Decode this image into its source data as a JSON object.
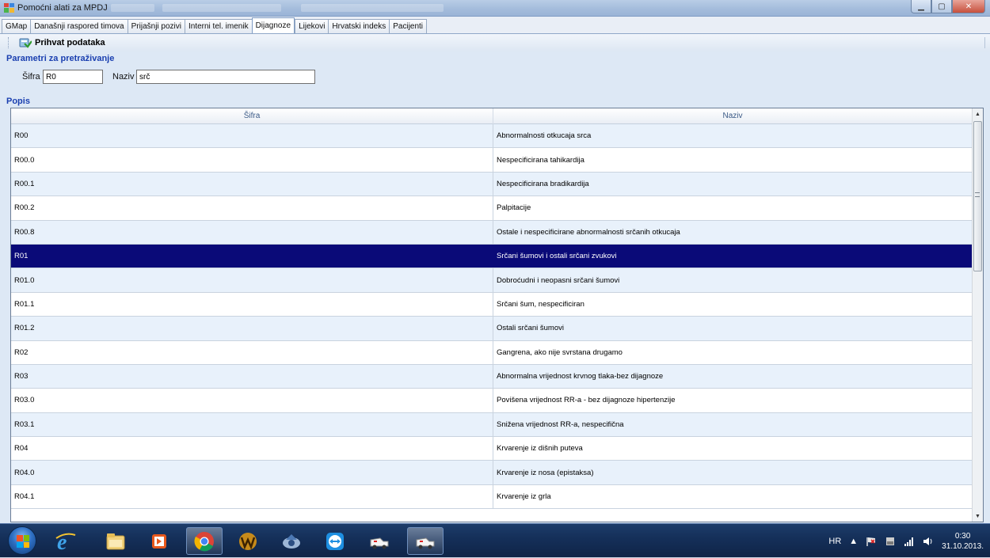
{
  "window": {
    "title": "Pomoćni alati za MPDJ"
  },
  "tabs": [
    {
      "label": "GMap",
      "active": false
    },
    {
      "label": "Današnji raspored timova",
      "active": false
    },
    {
      "label": "Prijašnji pozivi",
      "active": false
    },
    {
      "label": "Interni tel. imenik",
      "active": false
    },
    {
      "label": "Dijagnoze",
      "active": true
    },
    {
      "label": "Lijekovi",
      "active": false
    },
    {
      "label": "Hrvatski indeks",
      "active": false
    },
    {
      "label": "Pacijenti",
      "active": false
    }
  ],
  "toolbar": {
    "accept_label": "Prihvat podataka",
    "accept_icon": "accept-data-icon"
  },
  "search": {
    "section_title": "Parametri za pretraživanje",
    "sifra_label": "Šifra",
    "sifra_value": "R0",
    "naziv_label": "Naziv",
    "naziv_value": "srč"
  },
  "list": {
    "section_title": "Popis",
    "columns": [
      "Šifra",
      "Naziv"
    ],
    "selected_index": 5,
    "rows": [
      {
        "sifra": "R00",
        "naziv": "Abnormalnosti otkucaja srca"
      },
      {
        "sifra": "R00.0",
        "naziv": "Nespecificirana tahikardija"
      },
      {
        "sifra": "R00.1",
        "naziv": "Nespecificirana bradikardija"
      },
      {
        "sifra": "R00.2",
        "naziv": "Palpitacije"
      },
      {
        "sifra": "R00.8",
        "naziv": "Ostale i nespecificirane abnormalnosti srčanih otkucaja"
      },
      {
        "sifra": "R01",
        "naziv": "Srčani šumovi i ostali srčani zvukovi"
      },
      {
        "sifra": "R01.0",
        "naziv": "Dobroćudni i neopasni srčani šumovi"
      },
      {
        "sifra": "R01.1",
        "naziv": "Srčani šum, nespecificiran"
      },
      {
        "sifra": "R01.2",
        "naziv": "Ostali srčani šumovi"
      },
      {
        "sifra": "R02",
        "naziv": "Gangrena, ako nije svrstana drugamo"
      },
      {
        "sifra": "R03",
        "naziv": "Abnormalna vrijednost  krvnog tlaka-bez dijagnoze"
      },
      {
        "sifra": "R03.0",
        "naziv": "Povišena vrijednost RR-a - bez dijagnoze hipertenzije"
      },
      {
        "sifra": "R03.1",
        "naziv": "Snižena vrijednost RR-a, nespecifična"
      },
      {
        "sifra": "R04",
        "naziv": "Krvarenje iz dišnih puteva"
      },
      {
        "sifra": "R04.0",
        "naziv": "Krvarenje iz nosa (epistaksa)"
      },
      {
        "sifra": "R04.1",
        "naziv": "Krvarenje iz grla"
      }
    ]
  },
  "colors": {
    "selection": "#0a0a78",
    "section_title": "#1a3fb0",
    "header_text": "#3b5a86"
  },
  "taskbar": {
    "icons": [
      "start-orb",
      "internet-explorer-icon",
      "file-explorer-icon",
      "media-player-icon",
      "chrome-icon",
      "winamp-icon",
      "email-client-icon",
      "teamviewer-icon",
      "ambulance-app-icon",
      "ambulance-app-active-icon"
    ],
    "tray": {
      "language": "HR",
      "time": "0:30",
      "date": "31.10.2013."
    }
  }
}
